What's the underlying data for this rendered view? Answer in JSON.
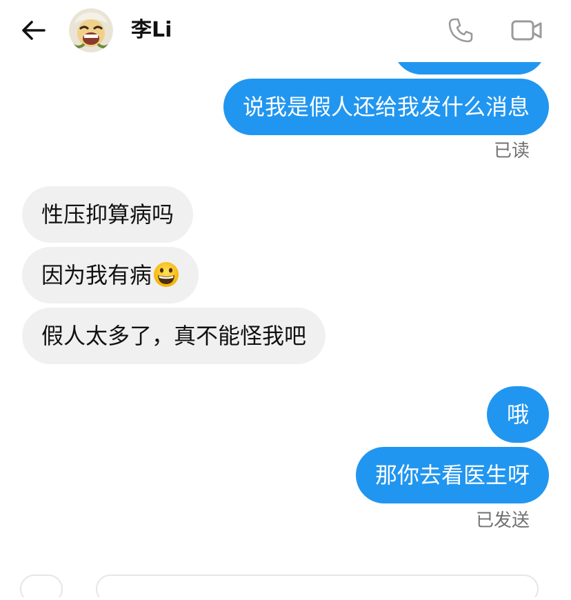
{
  "header": {
    "back_icon": "back-arrow-icon",
    "avatar_icon": "cartoon-avatar",
    "contact_name": "李Li",
    "call_icon": "phone-icon",
    "video_icon": "video-camera-icon"
  },
  "messages": [
    {
      "direction": "out",
      "text": ""
    },
    {
      "direction": "out",
      "text": "说我是假人还给我发什么消息"
    },
    {
      "direction": "status",
      "text": "已读"
    },
    {
      "direction": "in",
      "text": "性压抑算病吗"
    },
    {
      "direction": "in",
      "text": "因为我有病",
      "emoji": "grinning-face-emoji"
    },
    {
      "direction": "in",
      "text": "假人太多了，真不能怪我吧"
    },
    {
      "direction": "out",
      "text": "哦"
    },
    {
      "direction": "out",
      "text": "那你去看医生呀"
    },
    {
      "direction": "status",
      "text": "已发送"
    }
  ],
  "colors": {
    "outgoing_bubble": "#2196f0",
    "incoming_bubble": "#f0f0f0",
    "status_text": "#707070"
  }
}
